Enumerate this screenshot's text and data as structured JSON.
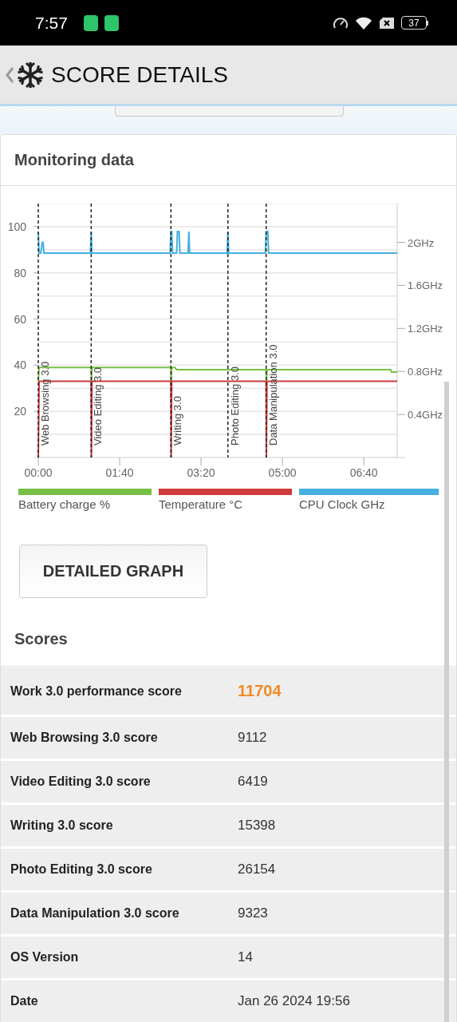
{
  "status_bar": {
    "time": "7:57",
    "battery": "37"
  },
  "app_bar": {
    "title": "SCORE DETAILS"
  },
  "monitoring": {
    "title": "Monitoring data",
    "chart_data": {
      "type": "line",
      "grid": true,
      "xlim": [
        0,
        441
      ],
      "ylim": [
        0,
        110
      ],
      "y2lim": [
        0,
        2.36
      ],
      "xticks": [
        {
          "value": 0,
          "label": "00:00"
        },
        {
          "value": 100,
          "label": "01:40"
        },
        {
          "value": 200,
          "label": "03:20"
        },
        {
          "value": 300,
          "label": "05:00"
        },
        {
          "value": 400,
          "label": "06:40"
        }
      ],
      "yticks": [
        20,
        40,
        60,
        80,
        100
      ],
      "y2ticks": [
        {
          "value": 0.4,
          "label": "0.4GHz"
        },
        {
          "value": 0.8,
          "label": "0.8GHz"
        },
        {
          "value": 1.2,
          "label": "1.2GHz"
        },
        {
          "value": 1.6,
          "label": "1.6GHz"
        },
        {
          "value": 2,
          "label": "2GHz"
        }
      ],
      "series": [
        {
          "name": "Battery charge %",
          "color": "#78c043",
          "x": [
            0,
            1,
            65,
            65.5,
            66,
            163,
            163.5,
            164,
            168,
            170,
            233,
            280,
            280.5,
            281,
            433,
            434,
            441
          ],
          "values": [
            33,
            39,
            39,
            33,
            39,
            39,
            33,
            39,
            39,
            38,
            38,
            38,
            33,
            38,
            38,
            37,
            37
          ]
        },
        {
          "name": "Temperature °C",
          "color": "#d03a3a",
          "x": [
            0,
            1,
            65,
            65.3,
            66,
            163,
            163.3,
            164,
            280,
            280.3,
            281,
            441
          ],
          "values": [
            0,
            33,
            33,
            0,
            33,
            33,
            0,
            33,
            33,
            0,
            33,
            33
          ]
        },
        {
          "name": "CPU Clock GHz",
          "color": "#45b0e0",
          "axis": "y2",
          "x": [
            0,
            1,
            3,
            5,
            6,
            7,
            9,
            64,
            65,
            66,
            162,
            163,
            164,
            165,
            170,
            171,
            173,
            174,
            184,
            185,
            186,
            232,
            233,
            234,
            279,
            280,
            282,
            283,
            441
          ],
          "values": [
            2.1,
            1.9,
            1.9,
            2.0,
            2.0,
            1.9,
            1.9,
            1.9,
            2.1,
            1.9,
            1.9,
            2.1,
            2.1,
            1.9,
            1.9,
            2.1,
            2.1,
            1.9,
            1.9,
            2.1,
            1.9,
            1.9,
            2.1,
            1.9,
            1.9,
            2.1,
            2.1,
            1.9,
            1.9
          ]
        }
      ],
      "ref_lines": [
        {
          "axis": "x",
          "value": 0,
          "label": "Web Browsing 3.0"
        },
        {
          "axis": "x",
          "value": 65,
          "label": "Video Editing 3.0"
        },
        {
          "axis": "x",
          "value": 163,
          "label": "Writing 3.0"
        },
        {
          "axis": "x",
          "value": 233,
          "label": "Photo Editing 3.0"
        },
        {
          "axis": "x",
          "value": 280,
          "label": "Data Manipulation 3.0"
        }
      ]
    },
    "button": "DETAILED GRAPH"
  },
  "scores": {
    "title": "Scores",
    "rows": [
      {
        "kind": "total",
        "label": "Work 3.0 performance score",
        "value": "11704"
      },
      {
        "kind": "plain",
        "label": "Web Browsing 3.0 score",
        "value": "9112"
      },
      {
        "kind": "plain",
        "label": "Video Editing 3.0 score",
        "value": "6419"
      },
      {
        "kind": "plain",
        "label": "Writing 3.0 score",
        "value": "15398"
      },
      {
        "kind": "plain",
        "label": "Photo Editing 3.0 score",
        "value": "26154"
      },
      {
        "kind": "plain",
        "label": "Data Manipulation 3.0 score",
        "value": "9323"
      },
      {
        "kind": "plain",
        "label": "OS Version",
        "value": "14"
      },
      {
        "kind": "plain",
        "label": "Date",
        "value": "Jan 26 2024 19:56"
      }
    ]
  }
}
